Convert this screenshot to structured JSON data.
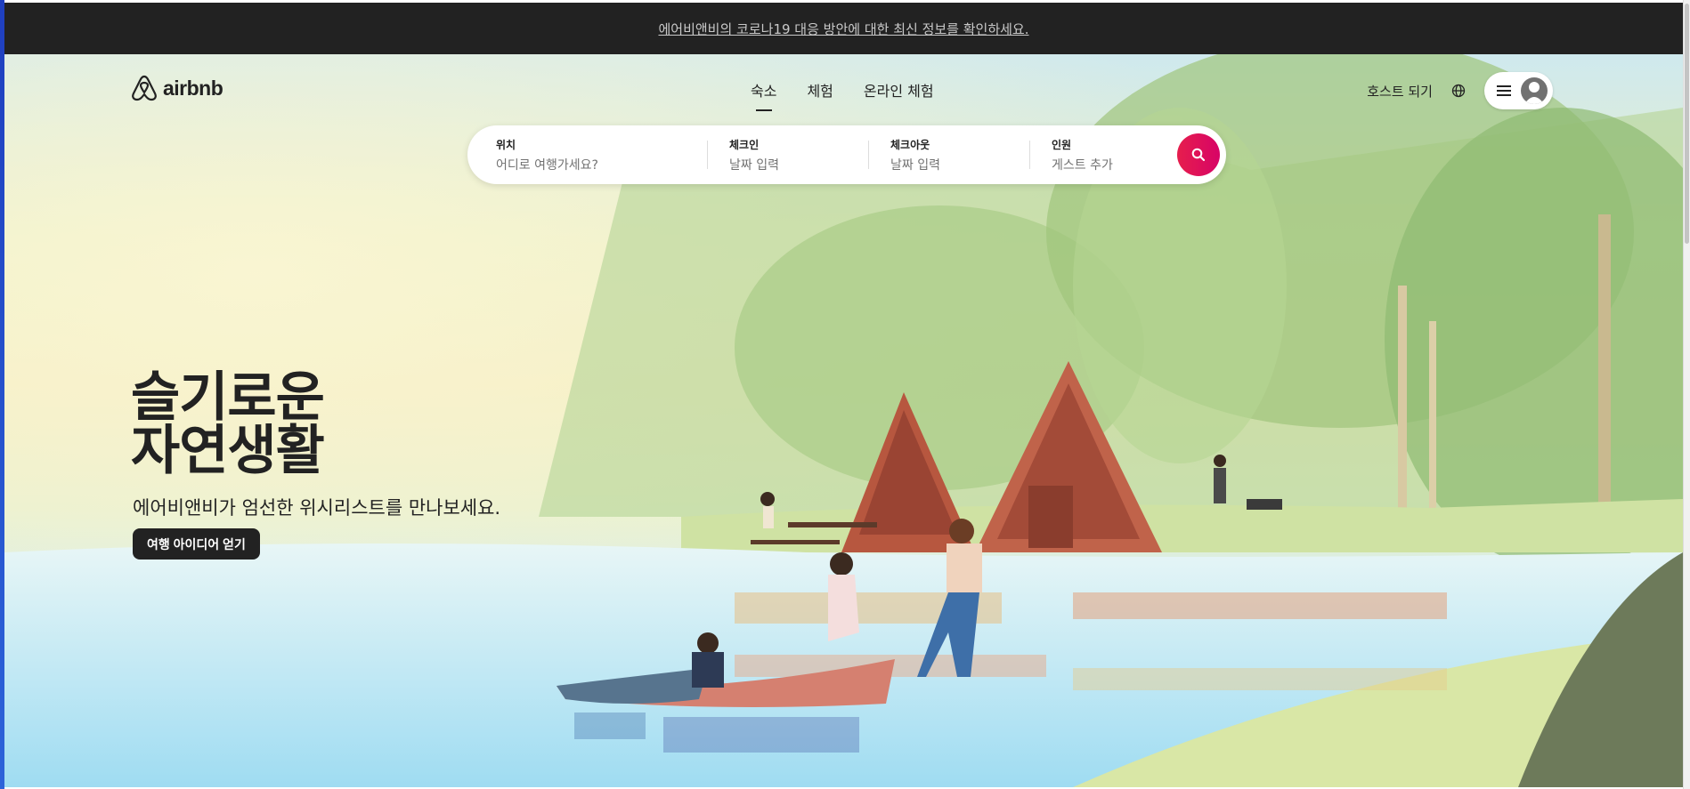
{
  "banner": {
    "text": "에어비앤비의 코로나19 대응 방안에 대한 최신 정보를 확인하세요."
  },
  "logo": {
    "text": "airbnb"
  },
  "nav": {
    "tabs": [
      {
        "label": "숙소",
        "active": true
      },
      {
        "label": "체험"
      },
      {
        "label": "온라인 체험"
      }
    ]
  },
  "header": {
    "host_label": "호스트 되기",
    "globe_icon": "globe-icon",
    "menu_icon": "hamburger-icon",
    "avatar_icon": "user-avatar-icon"
  },
  "search": {
    "location": {
      "label": "위치",
      "placeholder": "어디로 여행가세요?"
    },
    "checkin": {
      "label": "체크인",
      "placeholder": "날짜 입력"
    },
    "checkout": {
      "label": "체크아웃",
      "placeholder": "날짜 입력"
    },
    "guests": {
      "label": "인원",
      "placeholder": "게스트 추가"
    },
    "button_icon": "search-icon",
    "accent": "#e61e4d"
  },
  "hero": {
    "headline_line1": "슬기로운",
    "headline_line2": "자연생활",
    "subtitle": "에어비앤비가 엄선한 위시리스트를 만나보세요.",
    "cta_label": "여행 아이디어 얻기"
  }
}
